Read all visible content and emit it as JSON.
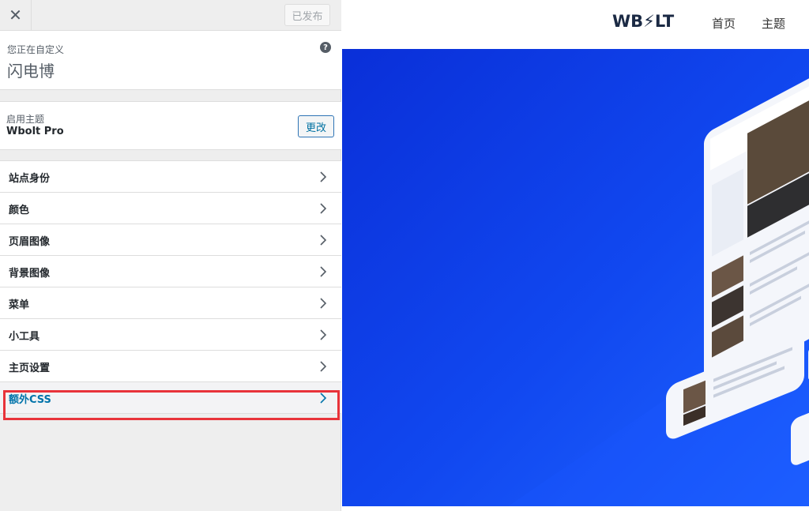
{
  "panel": {
    "close_label": "✕",
    "publish_label": "已发布",
    "customizing_label": "您正在自定义",
    "site_name": "闪电博",
    "help_label": "?",
    "theme_section": {
      "active_label": "启用主题",
      "theme_name": "Wbolt Pro",
      "change_label": "更改"
    },
    "menu": [
      {
        "label": "站点身份"
      },
      {
        "label": "颜色"
      },
      {
        "label": "页眉图像"
      },
      {
        "label": "背景图像"
      },
      {
        "label": "菜单"
      },
      {
        "label": "小工具"
      },
      {
        "label": "主页设置"
      },
      {
        "label": "额外CSS",
        "active": true
      }
    ]
  },
  "preview": {
    "logo": "WB⚡LT",
    "nav": [
      "首页",
      "主题"
    ],
    "hero_color": "#1148f0"
  },
  "colors": {
    "accent": "#0073aa",
    "highlight": "#e8333a"
  }
}
